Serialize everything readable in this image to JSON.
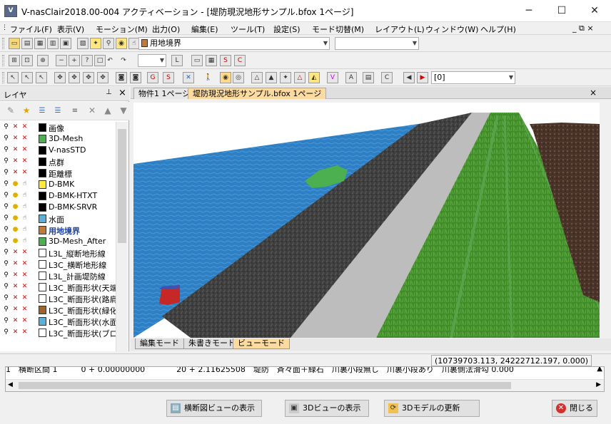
{
  "window": {
    "title": "V-nasClair2018.00-004 アクティベーション - [堤防現況地形サンプル.bfox 1ページ]",
    "app_icon_text": "V",
    "minimize_glyph": "─",
    "maximize_glyph": "☐",
    "close_glyph": "✕"
  },
  "menubar": {
    "items": [
      "ファイル(F)",
      "表示(V)",
      "モーション(M)",
      "出力(O)",
      "編集(E)",
      "ツール(T)",
      "設定(S)",
      "モード切替(M)",
      "レイアウト(L)",
      "ウィンドウ(W)",
      "ヘルプ(H)"
    ],
    "mdi_controls": "_ ⧉ ×"
  },
  "toolbar": {
    "layer_combo_value": "用地境界",
    "layer_combo_color": "#c07a3a",
    "second_combo_value": "",
    "color_combo_value": "",
    "page_combo_value": "[0]"
  },
  "layer_panel": {
    "title": "レイヤ",
    "pin_glyph": "📌",
    "close_glyph": "×",
    "layers": [
      {
        "name": "画像",
        "color": "#000000",
        "vis": "red",
        "bold": false
      },
      {
        "name": "3D-Mesh",
        "color": "#4caf50",
        "vis": "red",
        "bold": false
      },
      {
        "name": "V-nasSTD",
        "color": "#000000",
        "vis": "red",
        "bold": false
      },
      {
        "name": "点群",
        "color": "#000000",
        "vis": "red",
        "bold": false
      },
      {
        "name": "距離標",
        "color": "#000000",
        "vis": "red",
        "bold": false
      },
      {
        "name": "D-BMK",
        "color": "#ffeb3b",
        "vis": "yellow",
        "bold": false
      },
      {
        "name": "D-BMK-HTXT",
        "color": "#000000",
        "vis": "yellow",
        "bold": false
      },
      {
        "name": "D-BMK-SRVR",
        "color": "#000000",
        "vis": "yellow",
        "bold": false
      },
      {
        "name": "水面",
        "color": "#5ab0d8",
        "vis": "yellow",
        "bold": false
      },
      {
        "name": "用地境界",
        "color": "#c07a3a",
        "vis": "yellow",
        "bold": true
      },
      {
        "name": "3D-Mesh_After",
        "color": "#4caf50",
        "vis": "yellow",
        "bold": false
      },
      {
        "name": "L3L_縦断地形線",
        "color": "#ffffff",
        "vis": "red",
        "bold": false
      },
      {
        "name": "L3C_横断地形線",
        "color": "#ffffff",
        "vis": "red",
        "bold": false
      },
      {
        "name": "L3L_計画堤防線",
        "color": "#ffffff",
        "vis": "red",
        "bold": false
      },
      {
        "name": "L3C_断面形状(天端",
        "color": "#ffffff",
        "vis": "red",
        "bold": false
      },
      {
        "name": "L3C_断面形状(路肩",
        "color": "#ffffff",
        "vis": "red",
        "bold": false
      },
      {
        "name": "L3C_断面形状(緑化",
        "color": "#a0632a",
        "vis": "red",
        "bold": false
      },
      {
        "name": "L3C_断面形状(水面",
        "color": "#5ab0d8",
        "vis": "red",
        "bold": false
      },
      {
        "name": "L3C_断面形状(ブロ",
        "color": "#ffffff",
        "vis": "red",
        "bold": false
      }
    ]
  },
  "doc_tabs": [
    "物件1 1ページ",
    "堤防現況地形サンプル.bfox 1ページ"
  ],
  "mode_tabs": [
    "編集モード",
    "朱書きモード",
    "ビューモード"
  ],
  "status": {
    "coords": "(10739703.113, 24222712.197, 0.000)"
  },
  "table": {
    "row_text": "1　横断区間 1　　　0 + 0.00000000　　　　20 + 2.11625508　堤防　斉々面＋緑石　川裏小段無し　川裏小段あり　川裏側法滑勾 0.000"
  },
  "buttons": {
    "cross_section": "横断図ビューの表示",
    "view3d": "3Dビューの表示",
    "update3d": "3Dモデルの更新",
    "close": "閉じる"
  },
  "colors": {
    "water": "#2f7fc4",
    "asphalt": "#3f3f3f",
    "road": "#bdbdbd",
    "grass": "#3f8a2a",
    "soil": "#4a3328",
    "active_tab": "#fcdba0"
  }
}
